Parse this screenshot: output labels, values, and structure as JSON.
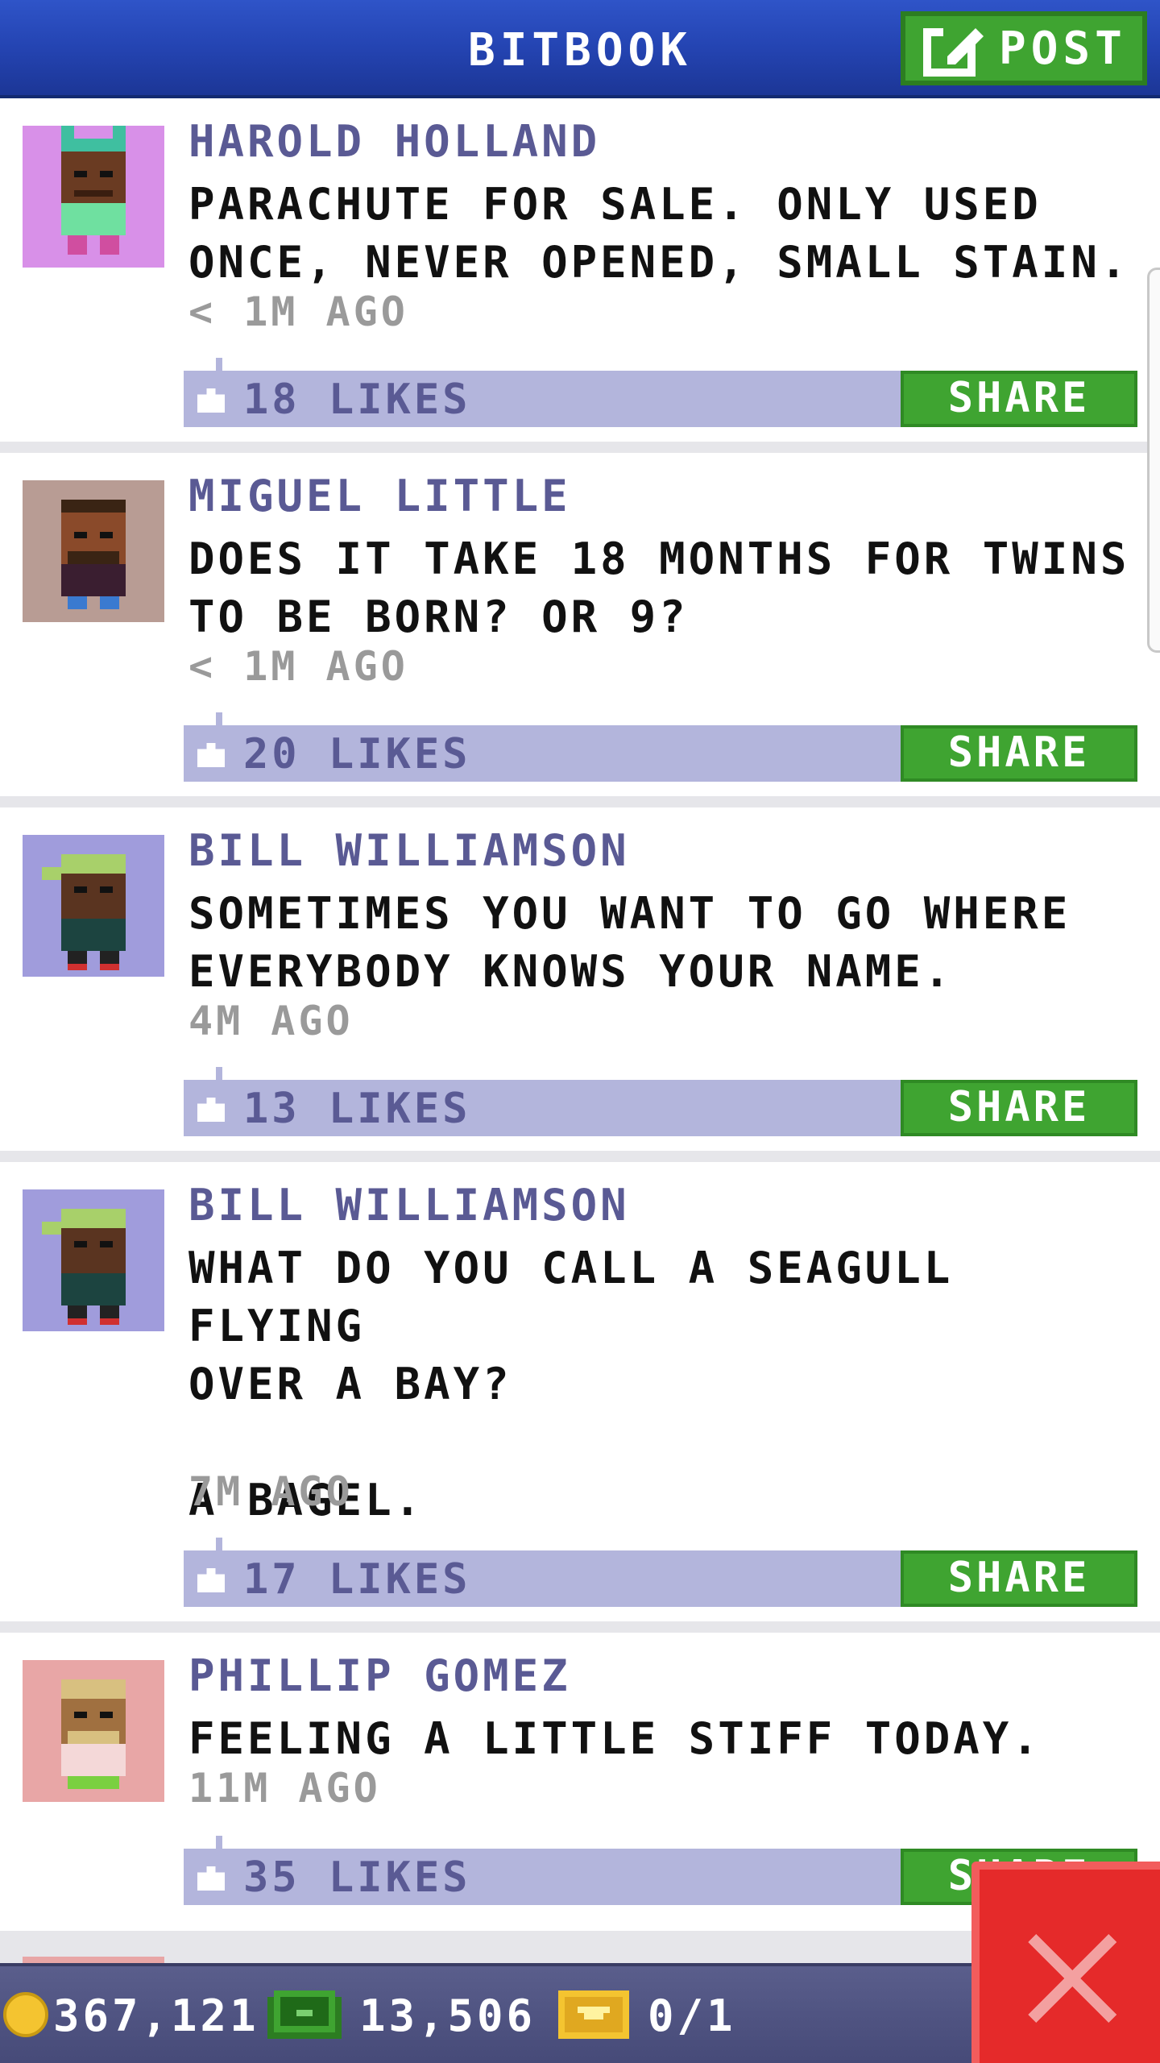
{
  "header": {
    "title": "BITBOOK",
    "post_label": "POST"
  },
  "posts": [
    {
      "name": "HAROLD HOLLAND",
      "text": "PARACHUTE FOR SALE. ONLY USED\nONCE, NEVER OPENED, SMALL STAIN.",
      "time": "< 1M AGO",
      "likes": "18 LIKES",
      "share_label": "SHARE",
      "avatar_bg": "#d890e8"
    },
    {
      "name": "MIGUEL LITTLE",
      "text": "DOES IT TAKE 18 MONTHS FOR TWINS\nTO BE BORN? OR 9?",
      "time": "< 1M AGO",
      "likes": "20 LIKES",
      "share_label": "SHARE",
      "avatar_bg": "#b89c94"
    },
    {
      "name": "BILL WILLIAMSON",
      "text": "SOMETIMES YOU WANT TO GO WHERE\nEVERYBODY KNOWS YOUR NAME.",
      "time": "4M AGO",
      "likes": "13 LIKES",
      "share_label": "SHARE",
      "avatar_bg": "#a09cdc"
    },
    {
      "name": "BILL WILLIAMSON",
      "text": "WHAT DO YOU CALL A SEAGULL FLYING\nOVER A BAY?\n\nA BAGEL.",
      "time": "7M AGO",
      "likes": "17 LIKES",
      "share_label": "SHARE",
      "avatar_bg": "#a09cdc"
    },
    {
      "name": "PHILLIP GOMEZ",
      "text": "FEELING A LITTLE STIFF TODAY.",
      "time": "11M AGO",
      "likes": "35 LIKES",
      "share_label": "SHARE",
      "avatar_bg": "#e8a6a6"
    }
  ],
  "status": {
    "coins": "367,121",
    "bux": "13,506",
    "tickets": "0/1"
  },
  "colors": {
    "header_blue": "#2444b2",
    "green": "#3fa431",
    "like_bar": "#b3b5dc",
    "name_purple": "#5a5a94",
    "close_red": "#e52a2a"
  },
  "icons": [
    "compose-icon",
    "thumbs-up-icon",
    "coin-icon",
    "cash-icon",
    "ticket-icon",
    "close-icon"
  ]
}
